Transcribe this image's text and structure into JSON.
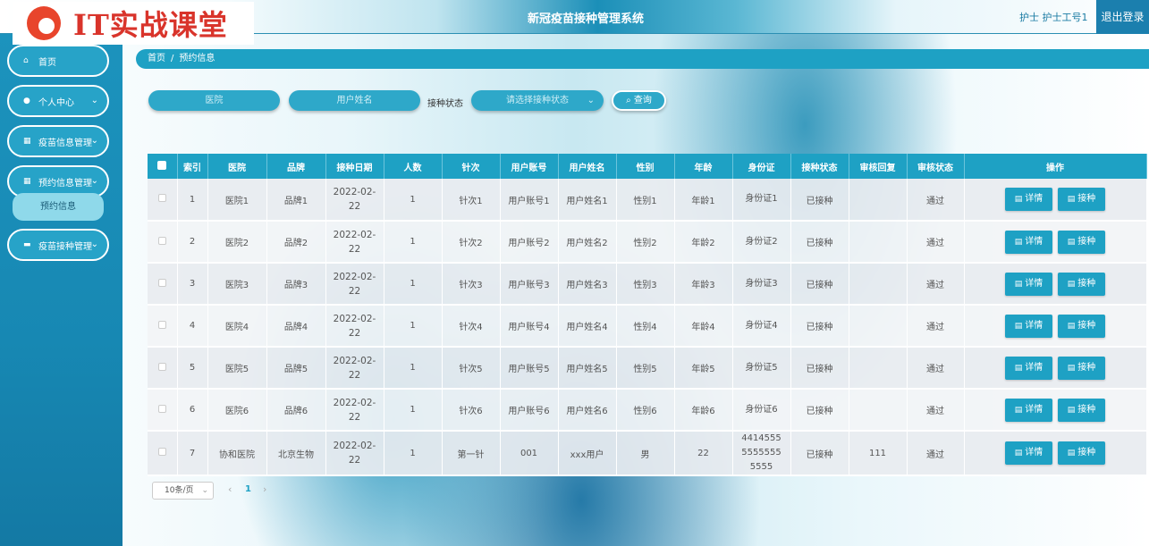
{
  "header": {
    "logo_text": "IT实战课堂",
    "app_title": "新冠疫苗接种管理系统",
    "user_label": "护士 护士工号1",
    "logout_label": "退出登录"
  },
  "sidebar": {
    "items": [
      {
        "label": "首页",
        "icon": "home-icon"
      },
      {
        "label": "个人中心",
        "icon": "user-icon"
      },
      {
        "label": "疫苗信息管理",
        "icon": "grid-icon"
      },
      {
        "label": "预约信息管理",
        "icon": "grid-icon"
      },
      {
        "label": "疫苗接种管理",
        "icon": "print-icon"
      }
    ],
    "sub_item": "预约信息"
  },
  "breadcrumb": {
    "home": "首页",
    "current": "预约信息"
  },
  "search": {
    "hospital_placeholder": "医院",
    "username_placeholder": "用户姓名",
    "status_label": "接种状态",
    "status_placeholder": "请选择接种状态",
    "query_label": "查询"
  },
  "table": {
    "headers": [
      "索引",
      "医院",
      "品牌",
      "接种日期",
      "人数",
      "针次",
      "用户账号",
      "用户姓名",
      "性别",
      "年龄",
      "身份证",
      "接种状态",
      "审核回复",
      "审核状态",
      "操作"
    ],
    "detail_label": "详情",
    "vaccinate_label": "接种",
    "rows": [
      {
        "idx": "1",
        "hospital": "医院1",
        "brand": "品牌1",
        "date": "2022-02-22",
        "count": "1",
        "dose": "针次1",
        "account": "用户账号1",
        "name": "用户姓名1",
        "gender": "性别1",
        "age": "年龄1",
        "idcard": "身份证1",
        "status": "已接种",
        "reply": "",
        "audit": "通过"
      },
      {
        "idx": "2",
        "hospital": "医院2",
        "brand": "品牌2",
        "date": "2022-02-22",
        "count": "1",
        "dose": "针次2",
        "account": "用户账号2",
        "name": "用户姓名2",
        "gender": "性别2",
        "age": "年龄2",
        "idcard": "身份证2",
        "status": "已接种",
        "reply": "",
        "audit": "通过"
      },
      {
        "idx": "3",
        "hospital": "医院3",
        "brand": "品牌3",
        "date": "2022-02-22",
        "count": "1",
        "dose": "针次3",
        "account": "用户账号3",
        "name": "用户姓名3",
        "gender": "性别3",
        "age": "年龄3",
        "idcard": "身份证3",
        "status": "已接种",
        "reply": "",
        "audit": "通过"
      },
      {
        "idx": "4",
        "hospital": "医院4",
        "brand": "品牌4",
        "date": "2022-02-22",
        "count": "1",
        "dose": "针次4",
        "account": "用户账号4",
        "name": "用户姓名4",
        "gender": "性别4",
        "age": "年龄4",
        "idcard": "身份证4",
        "status": "已接种",
        "reply": "",
        "audit": "通过"
      },
      {
        "idx": "5",
        "hospital": "医院5",
        "brand": "品牌5",
        "date": "2022-02-22",
        "count": "1",
        "dose": "针次5",
        "account": "用户账号5",
        "name": "用户姓名5",
        "gender": "性别5",
        "age": "年龄5",
        "idcard": "身份证5",
        "status": "已接种",
        "reply": "",
        "audit": "通过"
      },
      {
        "idx": "6",
        "hospital": "医院6",
        "brand": "品牌6",
        "date": "2022-02-22",
        "count": "1",
        "dose": "针次6",
        "account": "用户账号6",
        "name": "用户姓名6",
        "gender": "性别6",
        "age": "年龄6",
        "idcard": "身份证6",
        "status": "已接种",
        "reply": "",
        "audit": "通过"
      },
      {
        "idx": "7",
        "hospital": "协和医院",
        "brand": "北京生物",
        "date": "2022-02-22",
        "count": "1",
        "dose": "第一针",
        "account": "001",
        "name": "xxx用户",
        "gender": "男",
        "age": "22",
        "idcard": "441455555555555555",
        "status": "已接种",
        "reply": "111",
        "audit": "通过"
      }
    ]
  },
  "pagination": {
    "page_size": "10条/页",
    "current_page": "1"
  },
  "colors": {
    "accent": "#1ea1c4",
    "sidebar": "#1788b3",
    "logo_red": "#d9342b"
  }
}
